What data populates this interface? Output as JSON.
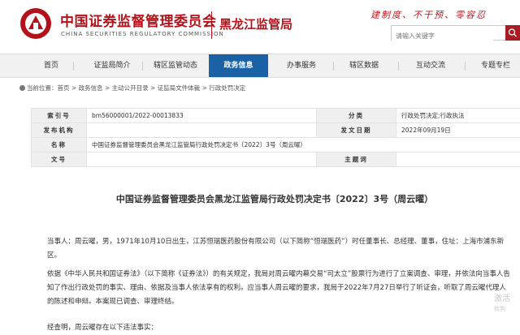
{
  "header": {
    "brand_cn": "中国证券监督管理委员会",
    "brand_en": "CHINA SECURITIES REGULATORY COMMISSION",
    "bureau": "黑龙江监管局",
    "slogan": "建制度、不干预、零容忍",
    "search_placeholder": "请输入关键字",
    "brand_color": "#b3121a"
  },
  "nav": {
    "items": [
      "首页",
      "证监局简介",
      "辖区监管动态",
      "政务信息",
      "办事服务",
      "辖区数据",
      "互动交流",
      "专题专栏"
    ],
    "active_index": 3,
    "active_color": "#1a62a5"
  },
  "breadcrumb": {
    "prefix": "当前位置：",
    "items": [
      "首页",
      "政务信息",
      "主动公开目录",
      "证监局文件体裁",
      "行政处罚决定"
    ],
    "separator": " > "
  },
  "meta": {
    "index_label": "索引号",
    "index_value": "bm56000001/2022-00013833",
    "category_label": "分类",
    "category_value": "行政处罚决定;行政执法",
    "publisher_label": "发布机构",
    "publisher_value": "",
    "date_label": "发文日期",
    "date_value": "2022年09月19日",
    "name_label": "名称",
    "name_value": "中国证券监督管理委员会黑龙江监管局行政处罚决定书〔2022〕3号（周云曜）",
    "docno_label": "文号",
    "docno_value": "",
    "subject_label": "主题词",
    "subject_value": ""
  },
  "document": {
    "title": "中国证券监督管理委员会黑龙江监管局行政处罚决定书〔2022〕3号（周云曜）",
    "paragraph1": "当事人：周云曜，男，1971年10月10日出生，江苏恒瑞医药股份有限公司（以下简称“恒瑞医药”）时任董事长、总经理、董事，住址：上海市浦东新区。",
    "paragraph2": "依据《中华人民共和国证券法》（以下简称《证券法》）的有关规定，我局对周云曜内幕交易“司太立”股票行为进行了立案调查、审理，并依法向当事人告知了作出行政处罚的事实、理由、依据及当事人依法享有的权利。应当事人周云曜的要求，我局于2022年7月27日举行了听证会，听取了周云曜代理人的陈述和申辩。本案现已调查、审理终结。",
    "paragraph3": "经查明，周云曜存在以下违法事实："
  },
  "watermark": {
    "line1": "激活",
    "line2": "转到"
  }
}
